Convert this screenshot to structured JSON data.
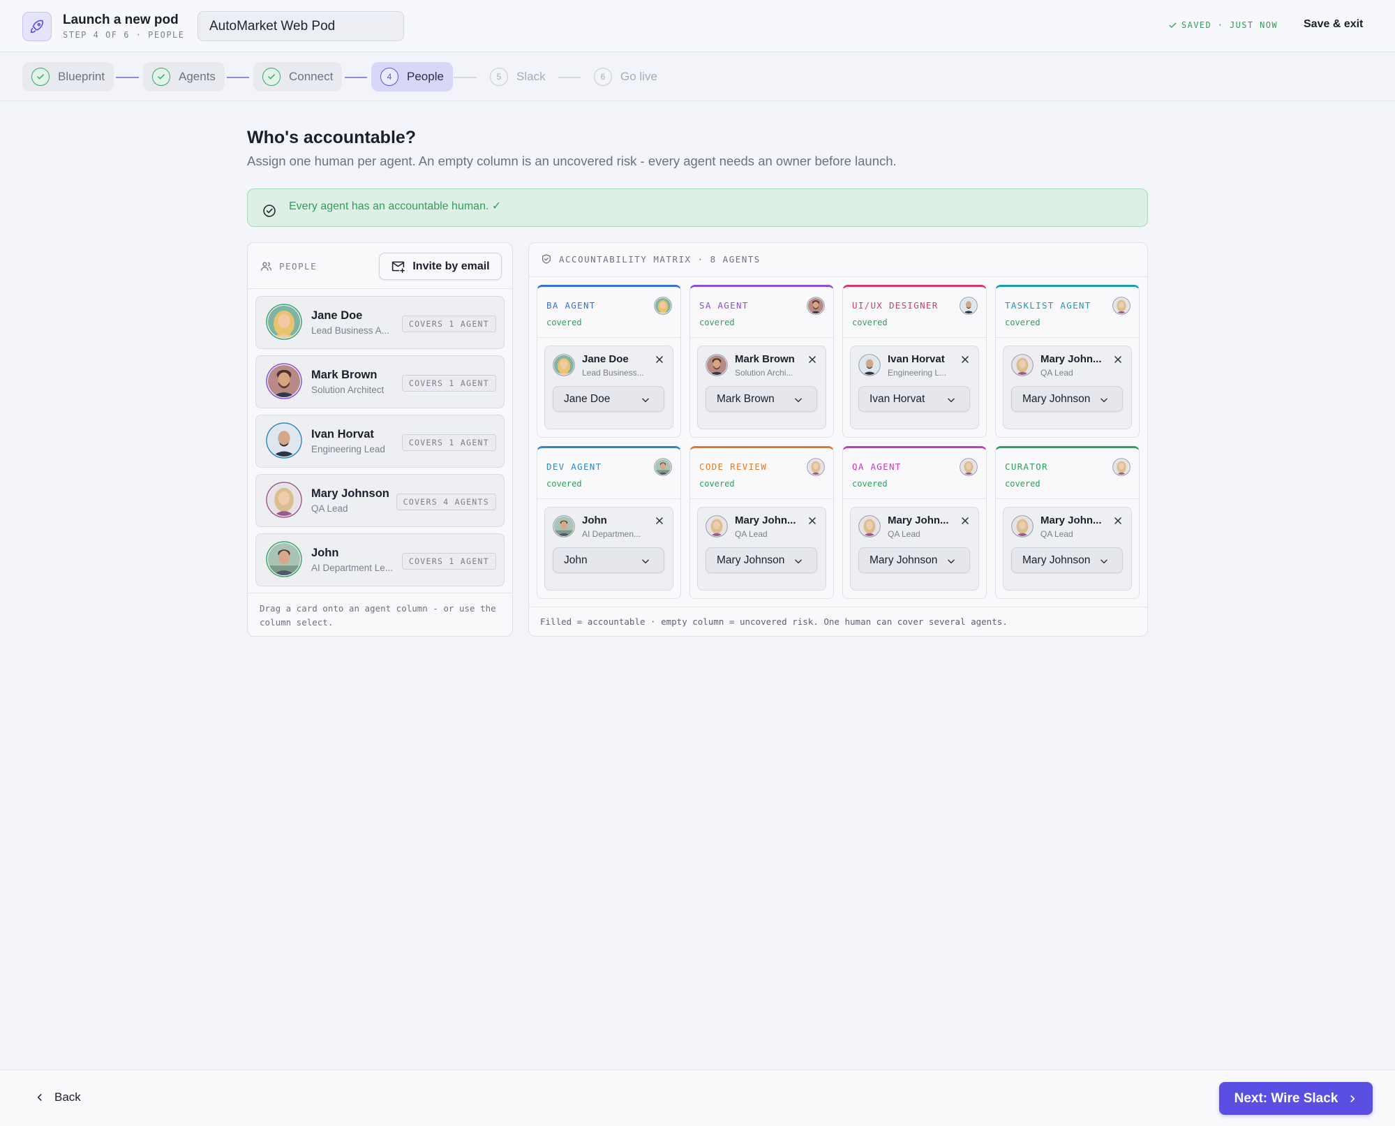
{
  "header": {
    "title": "Launch a new pod",
    "subtitle": "STEP 4 OF 6 · PEOPLE",
    "pod_name": "AutoMarket Web Pod",
    "saved_status": "SAVED · JUST NOW",
    "save_exit": "Save & exit"
  },
  "stepper": [
    {
      "label": "Blueprint",
      "state": "done"
    },
    {
      "label": "Agents",
      "state": "done"
    },
    {
      "label": "Connect",
      "state": "done"
    },
    {
      "label": "People",
      "number": "4",
      "state": "active"
    },
    {
      "label": "Slack",
      "number": "5",
      "state": "todo"
    },
    {
      "label": "Go live",
      "number": "6",
      "state": "todo"
    }
  ],
  "page": {
    "title": "Who's accountable?",
    "description": "Assign one human per agent. An empty column is an uncovered risk - every agent needs an owner before launch.",
    "banner": "Every agent has an accountable human. ✓"
  },
  "people_panel": {
    "label": "PEOPLE",
    "invite": "Invite by email",
    "people": [
      {
        "name": "Jane Doe",
        "role": "Lead Business A...",
        "covers": "COVERS 1 AGENT"
      },
      {
        "name": "Mark Brown",
        "role": "Solution Architect",
        "covers": "COVERS 1 AGENT"
      },
      {
        "name": "Ivan Horvat",
        "role": "Engineering Lead",
        "covers": "COVERS 1 AGENT"
      },
      {
        "name": "Mary Johnson",
        "role": "QA Lead",
        "covers": "COVERS 4 AGENTS"
      },
      {
        "name": "John",
        "role": "AI Department Le...",
        "covers": "COVERS 1 AGENT"
      }
    ],
    "footer": "Drag a card onto an agent column - or use the column select."
  },
  "matrix": {
    "label": "ACCOUNTABILITY MATRIX · 8 AGENTS",
    "footer": "Filled = accountable · empty column = uncovered risk. One human can cover several agents.",
    "columns": [
      {
        "agent": "BA AGENT",
        "status": "covered",
        "color": "#3b6fd6",
        "owner": "Jane Doe",
        "owner_role": "Lead Business...",
        "select": "Jane Doe"
      },
      {
        "agent": "SA AGENT",
        "status": "covered",
        "color": "#8a4fd8",
        "owner": "Mark Brown",
        "owner_role": "Solution Archi...",
        "select": "Mark Brown"
      },
      {
        "agent": "UI/UX DESIGNER",
        "status": "covered",
        "color": "#d6386e",
        "owner": "Ivan Horvat",
        "owner_role": "Engineering L...",
        "select": "Ivan Horvat"
      },
      {
        "agent": "TASKLIST AGENT",
        "status": "covered",
        "color": "#1a9bb0",
        "owner": "Mary John...",
        "owner_role": "QA Lead",
        "select": "Mary Johnson"
      },
      {
        "agent": "DEV AGENT",
        "status": "covered",
        "color": "#2a88c9",
        "owner": "John",
        "owner_role": "AI Departmen...",
        "select": "John"
      },
      {
        "agent": "CODE REVIEW",
        "status": "covered",
        "color": "#e07a22",
        "owner": "Mary John...",
        "owner_role": "QA Lead",
        "select": "Mary Johnson"
      },
      {
        "agent": "QA AGENT",
        "status": "covered",
        "color": "#c93ab8",
        "owner": "Mary John...",
        "owner_role": "QA Lead",
        "select": "Mary Johnson"
      },
      {
        "agent": "CURATOR",
        "status": "covered",
        "color": "#2f9e5b",
        "owner": "Mary John...",
        "owner_role": "QA Lead",
        "select": "Mary Johnson"
      }
    ]
  },
  "footer_nav": {
    "back": "Back",
    "next": "Next: Wire Slack"
  },
  "colors": {
    "accent": "#5b4fe3",
    "success": "#2f9e5b"
  }
}
